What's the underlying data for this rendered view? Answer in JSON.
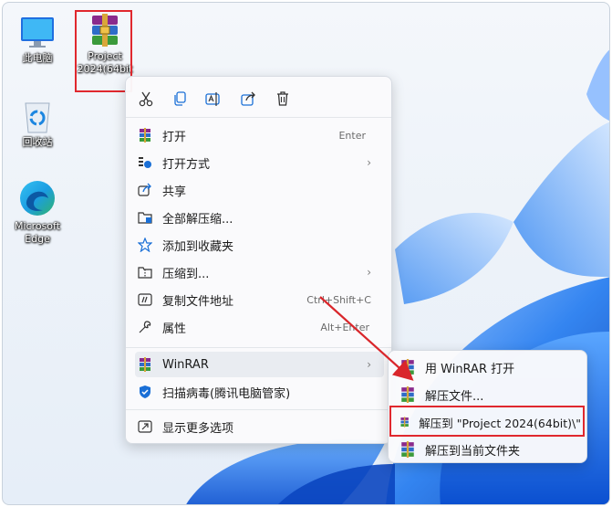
{
  "desktop": {
    "icons": [
      {
        "label": "此电脑",
        "icon": "monitor-icon"
      },
      {
        "label": "回收站",
        "icon": "recycle-bin-icon"
      },
      {
        "label_line1": "Microsoft",
        "label_line2": "Edge",
        "icon": "edge-icon"
      },
      {
        "label_line1": "Project",
        "label_line2": "2024(64bit",
        "icon": "winrar-archive-icon"
      }
    ]
  },
  "quick_actions": [
    {
      "name": "cut",
      "icon": "scissors-icon"
    },
    {
      "name": "copy",
      "icon": "copy-icon"
    },
    {
      "name": "rename",
      "icon": "rename-icon"
    },
    {
      "name": "share",
      "icon": "share-icon"
    },
    {
      "name": "delete",
      "icon": "trash-icon"
    }
  ],
  "menu": {
    "items": [
      {
        "label": "打开",
        "shortcut": "Enter",
        "icon": "winrar-icon"
      },
      {
        "label": "打开方式",
        "icon": "open-with-icon",
        "submenu": true
      },
      {
        "label": "共享",
        "icon": "share-icon"
      },
      {
        "label": "全部解压缩...",
        "icon": "extract-all-icon"
      },
      {
        "label": "添加到收藏夹",
        "icon": "star-icon"
      },
      {
        "label": "压缩到...",
        "icon": "compress-icon",
        "submenu": true
      },
      {
        "label": "复制文件地址",
        "shortcut": "Ctrl+Shift+C",
        "icon": "copy-path-icon"
      },
      {
        "label": "属性",
        "shortcut": "Alt+Enter",
        "icon": "wrench-icon"
      },
      {
        "label": "WinRAR",
        "icon": "winrar-icon",
        "submenu": true
      },
      {
        "label": "扫描病毒(腾讯电脑管家)",
        "icon": "shield-icon"
      },
      {
        "label": "显示更多选项",
        "icon": "more-options-icon"
      }
    ],
    "chevron": "›"
  },
  "submenu": {
    "items": [
      {
        "label": "用 WinRAR 打开"
      },
      {
        "label": "解压文件..."
      },
      {
        "label": "解压到 \"Project 2024(64bit)\\\""
      },
      {
        "label": "解压到当前文件夹"
      }
    ]
  },
  "colors": {
    "highlight_box": "#e0282e",
    "arrow": "#d9262b",
    "bloom_blue": "#1e6fe8"
  }
}
